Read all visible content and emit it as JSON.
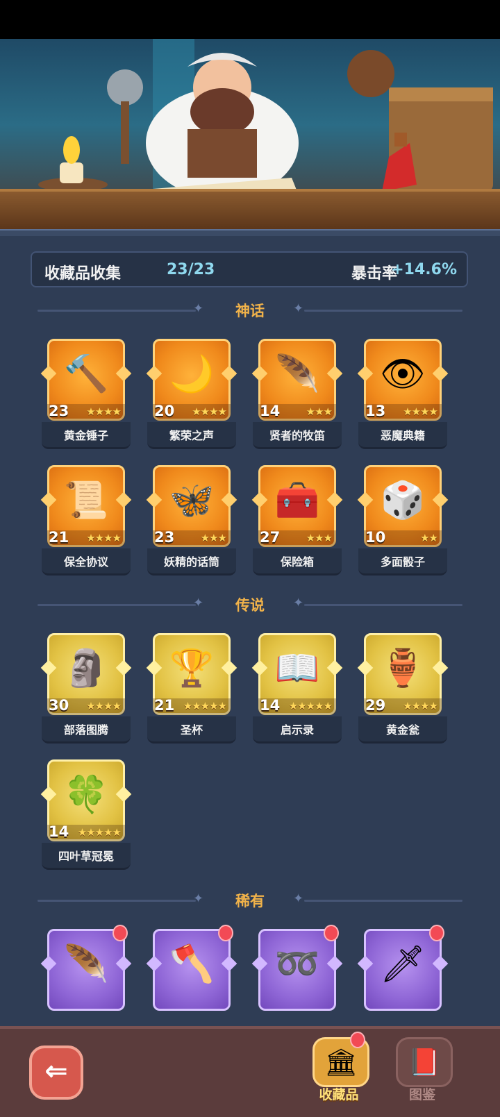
{
  "summary": {
    "label": "收藏品收集",
    "count": "23/23",
    "crit_label": "暴击率",
    "crit_value": "+14.6%"
  },
  "sections": [
    {
      "title": "神话",
      "rarity": "mythic",
      "items": [
        {
          "name": "黄金锤子",
          "level": "23",
          "stars": "★★★★",
          "icon": "hammer-icon",
          "glyph": "🔨"
        },
        {
          "name": "繁荣之声",
          "level": "20",
          "stars": "★★★★",
          "icon": "moon-orb-icon",
          "glyph": "🌙"
        },
        {
          "name": "贤者的牧笛",
          "level": "14",
          "stars": "★★★",
          "icon": "flute-icon",
          "glyph": "🪶"
        },
        {
          "name": "恶魔典籍",
          "level": "13",
          "stars": "★★★★",
          "icon": "demon-book-icon",
          "glyph": "👁"
        },
        {
          "name": "保全协议",
          "level": "21",
          "stars": "★★★★",
          "icon": "scroll-icon",
          "glyph": "📜"
        },
        {
          "name": "妖精的话筒",
          "level": "23",
          "stars": "★★★",
          "icon": "butterfly-mic-icon",
          "glyph": "🦋"
        },
        {
          "name": "保险箱",
          "level": "27",
          "stars": "★★★",
          "icon": "treasure-chest-icon",
          "glyph": "🧰"
        },
        {
          "name": "多面骰子",
          "level": "10",
          "stars": "★★",
          "icon": "dice-icon",
          "glyph": "🎲"
        }
      ]
    },
    {
      "title": "传说",
      "rarity": "legend",
      "items": [
        {
          "name": "部落图腾",
          "level": "30",
          "stars": "★★★★",
          "icon": "totem-icon",
          "glyph": "🗿"
        },
        {
          "name": "圣杯",
          "level": "21",
          "stars": "★★★★★",
          "icon": "grail-icon",
          "glyph": "🏆"
        },
        {
          "name": "启示录",
          "level": "14",
          "stars": "★★★★★",
          "icon": "open-book-icon",
          "glyph": "📖"
        },
        {
          "name": "黄金瓮",
          "level": "29",
          "stars": "★★★★",
          "icon": "urn-icon",
          "glyph": "🏺"
        },
        {
          "name": "四叶草冠冕",
          "level": "14",
          "stars": "★★★★★",
          "icon": "clover-crown-icon",
          "glyph": "🍀"
        }
      ]
    },
    {
      "title": "稀有",
      "rarity": "rare",
      "items": [
        {
          "icon": "feather-icon",
          "glyph": "🪶"
        },
        {
          "icon": "axe-icon",
          "glyph": "🪓"
        },
        {
          "icon": "vine-chain-icon",
          "glyph": "➿"
        },
        {
          "icon": "dagger-icon",
          "glyph": "🗡"
        }
      ]
    }
  ],
  "nav": {
    "tab_collection": "收藏品",
    "tab_codex": "图鉴",
    "collection_glyph": "🏛",
    "codex_glyph": "📕",
    "back_glyph": "⇐"
  }
}
